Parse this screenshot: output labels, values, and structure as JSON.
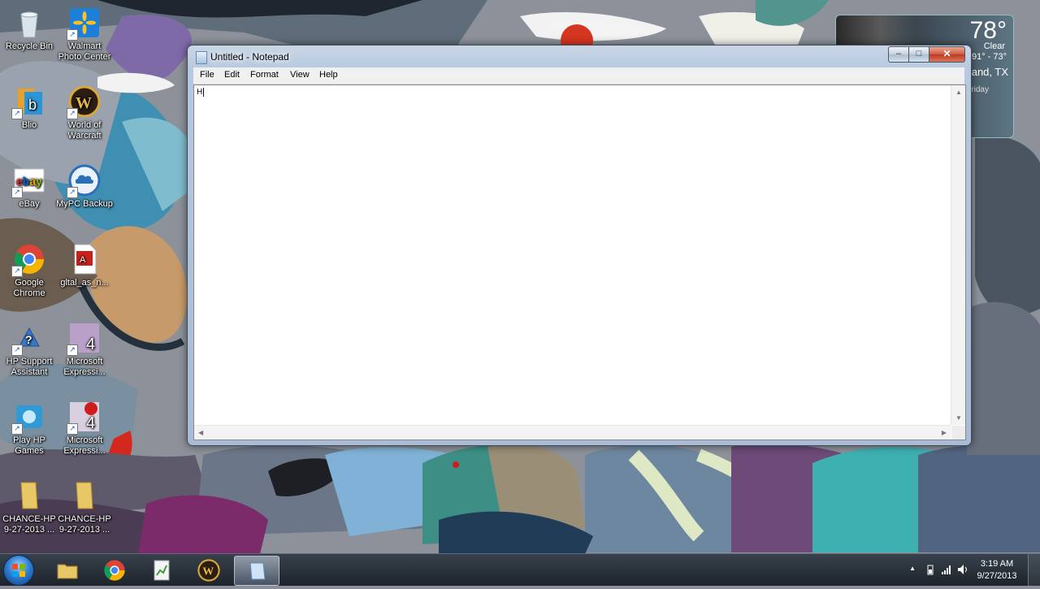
{
  "desktop": {
    "icons": [
      {
        "label": "Recycle Bin"
      },
      {
        "label": "Walmart Photo Center"
      },
      {
        "label": "Blio"
      },
      {
        "label": "World of Warcraft"
      },
      {
        "label": "eBay"
      },
      {
        "label": "MyPC Backup"
      },
      {
        "label": "Google Chrome"
      },
      {
        "label": "gltal_as_n..."
      },
      {
        "label": "HP Support Assistant"
      },
      {
        "label": "Microsoft Expressi..."
      },
      {
        "label": "Play HP Games"
      },
      {
        "label": "Microsoft Expressi..."
      },
      {
        "label": "CHANCE-HP 9-27-2013 ..."
      },
      {
        "label": "CHANCE-HP 9-27-2013 ..."
      }
    ]
  },
  "weather": {
    "temp": "78°",
    "condition": "Clear",
    "range": "91° - 73°",
    "location": "Pearland, TX",
    "day": "Friday"
  },
  "notepad": {
    "title": "Untitled - Notepad",
    "menu": [
      "File",
      "Edit",
      "Format",
      "View",
      "Help"
    ],
    "content": "H",
    "buttons": {
      "minimize": "–",
      "maximize": "□",
      "close": "✕"
    }
  },
  "taskbar": {
    "clock_time": "3:19 AM",
    "clock_date": "9/27/2013",
    "tray_expand": "▲"
  },
  "colors": {
    "taskbar": "#1c2430",
    "close_button": "#c7472c",
    "window_frame": "#b7c9de"
  }
}
